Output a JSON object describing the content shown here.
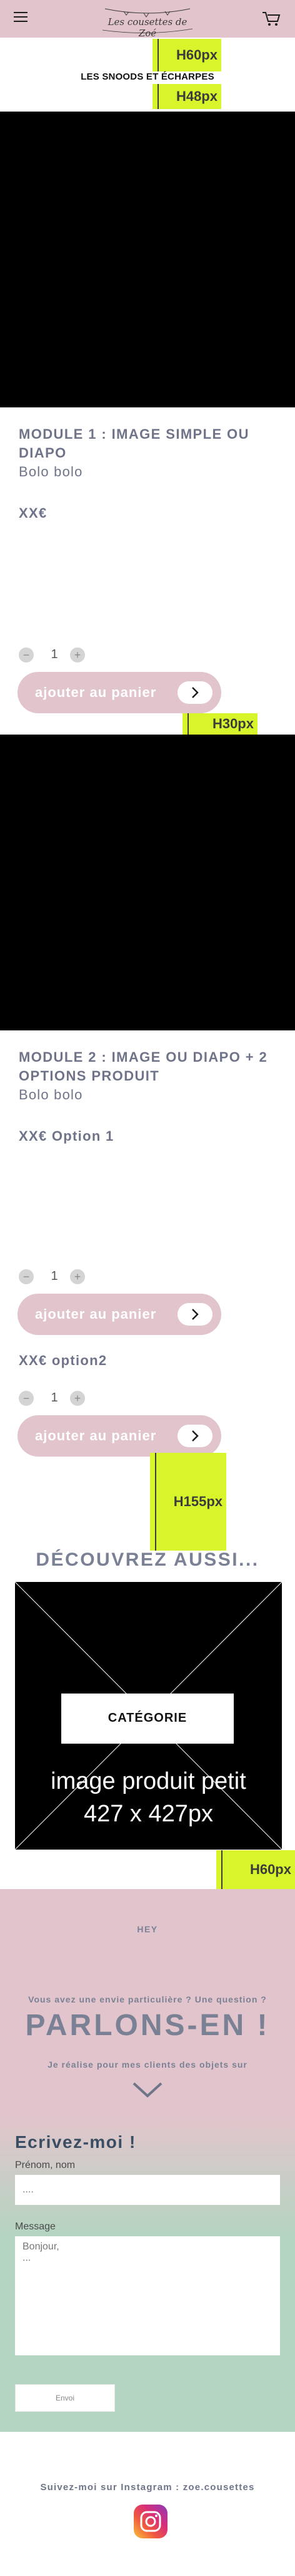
{
  "header": {
    "logo_text": "Les cousettes de Zoé",
    "menu_icon": "hamburger-icon",
    "cart_icon": "shopping-cart-icon",
    "background": "#e2c5cc"
  },
  "markers": {
    "top": "H60px",
    "category": "H48px",
    "between_modules": "H30px",
    "before_discover": "H155px",
    "before_contact": "H60px",
    "color": "#d8f52b"
  },
  "category_title": "LES SNOODS ET ÉCHARPES",
  "modules": [
    {
      "title": "MODULE 1 : IMAGE SIMPLE OU DIAPO",
      "subtitle": "Bolo bolo",
      "price": "XX€",
      "quantity": "1",
      "add_to_cart": "ajouter au panier"
    },
    {
      "title": "MODULE 2 : IMAGE OU DIAPO + 2 OPTIONS PRODUIT",
      "subtitle": "Bolo bolo",
      "options": [
        {
          "price": "XX€ Option 1",
          "quantity": "1",
          "add_to_cart": "ajouter au panier"
        },
        {
          "price": "XX€ option2",
          "quantity": "1",
          "add_to_cart": "ajouter au panier"
        }
      ]
    }
  ],
  "discover": {
    "title": "DÉCOUVREZ AUSSI...",
    "category_button": "CATÉGORIE",
    "product_caption_line1": "image produit petit",
    "product_caption_line2": "427 x 427px"
  },
  "contact": {
    "hey": "HEY",
    "question": "Vous avez une envie particulière ? Une question ?",
    "headline": "PARLONS-EN !",
    "description": "Je réalise pour mes clients des objets sur",
    "form_title": "Ecrivez-moi !",
    "name_label": "Prénom, nom",
    "name_value": "....",
    "message_label": "Message",
    "message_value": "Bonjour,\n...",
    "submit_label": "Envoi"
  },
  "instagram": {
    "text": "Suivez-moi sur Instagram : zoe.cousettes",
    "icon": "instagram-icon"
  }
}
